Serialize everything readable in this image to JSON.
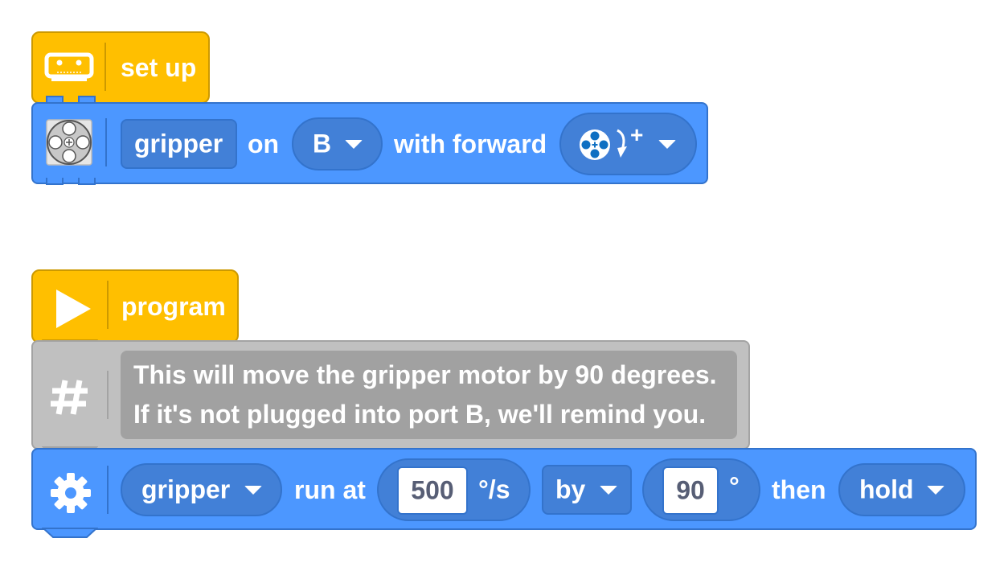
{
  "colors": {
    "hat": "#ffbf00",
    "motor_block": "#4c97ff",
    "comment_block": "#c0c0c0",
    "input_pill": "#4280d7",
    "field_text": "#575e75"
  },
  "setup_stack": {
    "hat": {
      "icon": "hub-icon",
      "label": "set up"
    },
    "motor_setup": {
      "icon": "motor-icon",
      "name_label": "gripper",
      "on_label": "on",
      "port": "B",
      "with_forward_label": "with forward",
      "direction_icon": "clockwise-direction-icon",
      "direction_symbol": "+"
    }
  },
  "program_stack": {
    "hat": {
      "icon": "play-icon",
      "label": "program"
    },
    "comment": {
      "icon": "hash-icon",
      "lines": [
        "This will  move the gripper motor by 90 degrees.",
        "If it's not plugged into port B, we'll remind you."
      ]
    },
    "motor_run": {
      "icon": "gear-icon",
      "motor": "gripper",
      "run_at_label": "run at",
      "speed_value": "500",
      "speed_unit": "°/s",
      "by_option": "by",
      "amount_value": "90",
      "amount_unit": "°",
      "then_label": "then",
      "then_option": "hold"
    }
  }
}
